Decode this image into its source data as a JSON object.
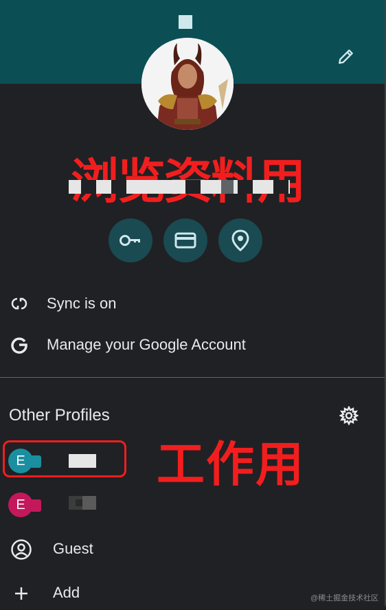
{
  "header": {
    "background": "#0b4f55"
  },
  "annotations": {
    "profile_note": "浏览资料用",
    "work_note": "工作用",
    "annotation_color": "#f21e1e"
  },
  "quick_actions": [
    {
      "icon": "key-icon"
    },
    {
      "icon": "credit-card-icon"
    },
    {
      "icon": "location-pin-icon"
    }
  ],
  "menu": {
    "sync_label": "Sync is on",
    "google_account_label": "Manage your Google Account"
  },
  "other_profiles": {
    "title": "Other Profiles",
    "profiles": [
      {
        "initial": "E",
        "color": "#1a8fa0",
        "badge_color": "#1a8fa0"
      },
      {
        "initial": "E",
        "color": "#c4185c",
        "badge_color": "#c4185c"
      }
    ]
  },
  "bottom": {
    "guest_label": "Guest",
    "add_label": "Add"
  },
  "watermark": "@稀土掘金技术社区"
}
